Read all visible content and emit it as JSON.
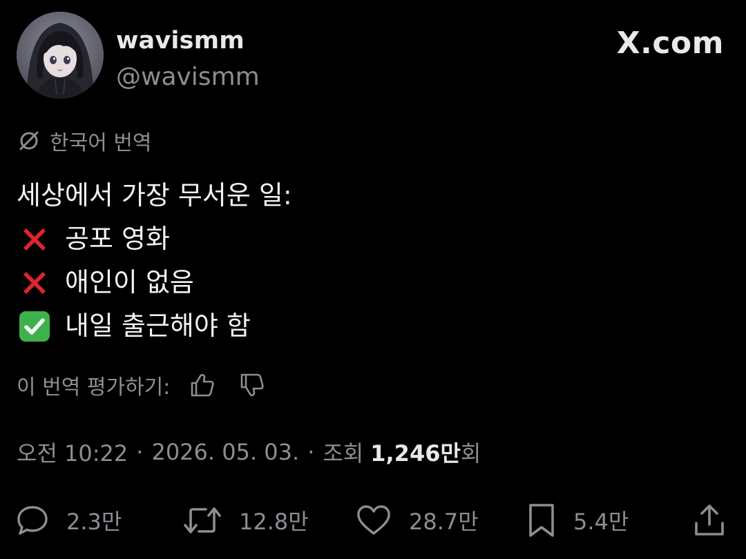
{
  "author": {
    "display_name": "wavismm",
    "handle": "@wavismm"
  },
  "brand": {
    "label": "X.com"
  },
  "translation": {
    "label": "한국어 번역"
  },
  "tweet": {
    "lines": [
      {
        "marker": "",
        "text": "세상에서 가장 무서운 일:"
      },
      {
        "marker": "cross-mark-icon",
        "text": "공포 영화"
      },
      {
        "marker": "cross-mark-icon",
        "text": "애인이 없음"
      },
      {
        "marker": "check-mark-icon",
        "text": "내일 출근해야 함"
      }
    ]
  },
  "rate_translation": {
    "label": "이 번역 평가하기:"
  },
  "meta": {
    "time": "오전 10:22",
    "separator": "·",
    "date": "2026. 05. 03.",
    "views_prefix": "조회",
    "views_count": "1,246만",
    "views_suffix": "회"
  },
  "actions": {
    "reply_count": "2.3만",
    "retweet_count": "12.8만",
    "like_count": "28.7만",
    "bookmark_count": "5.4만"
  },
  "colors": {
    "background": "#000000",
    "primary_text": "#e7e9ea",
    "secondary_text": "#8b8f94",
    "cross_red": "#e0242b",
    "check_green": "#3fb14a"
  }
}
